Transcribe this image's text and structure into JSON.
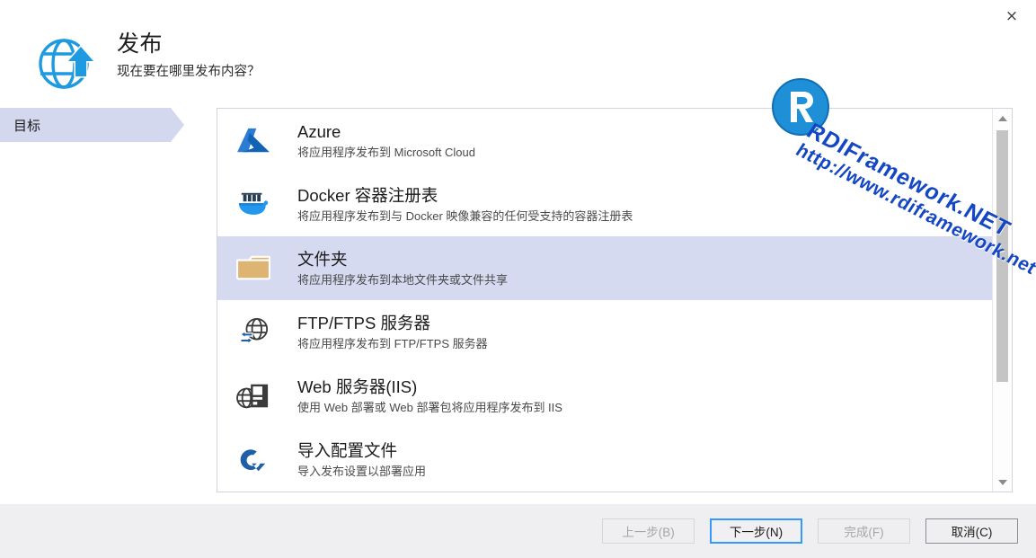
{
  "window": {
    "close_label": "×"
  },
  "header": {
    "icon": "globe-upload-icon",
    "title": "发布",
    "subtitle": "现在要在哪里发布内容？"
  },
  "sidebar": {
    "items": [
      {
        "label": "目标",
        "active": true
      }
    ]
  },
  "destinations": [
    {
      "icon": "azure-icon",
      "title": "Azure",
      "description": "将应用程序发布到 Microsoft Cloud",
      "selected": false
    },
    {
      "icon": "docker-icon",
      "title": "Docker 容器注册表",
      "description": "将应用程序发布到与 Docker 映像兼容的任何受支持的容器注册表",
      "selected": false
    },
    {
      "icon": "folder-icon",
      "title": "文件夹",
      "description": "将应用程序发布到本地文件夹或文件共享",
      "selected": true
    },
    {
      "icon": "ftp-icon",
      "title": "FTP/FTPS 服务器",
      "description": "将应用程序发布到 FTP/FTPS 服务器",
      "selected": false
    },
    {
      "icon": "iis-server-icon",
      "title": "Web 服务器(IIS)",
      "description": "使用 Web 部署或 Web 部署包将应用程序发布到 IIS",
      "selected": false
    },
    {
      "icon": "import-profile-icon",
      "title": "导入配置文件",
      "description": "导入发布设置以部署应用",
      "selected": false
    }
  ],
  "footer": {
    "buttons": [
      {
        "label": "上一步(B)",
        "state": "disabled"
      },
      {
        "label": "下一步(N)",
        "state": "focused"
      },
      {
        "label": "完成(F)",
        "state": "disabled"
      },
      {
        "label": "取消(C)",
        "state": "enabled"
      }
    ]
  },
  "watermark": {
    "logo": "rdi-r-logo",
    "line1": "RDIFramework.NET",
    "line2": "http://www.rdiframework.net",
    "color": "#1447c4"
  },
  "colors": {
    "selection": "#d5daf0",
    "sidebar_active": "#d3d8ef",
    "footer_bg": "#efeff1",
    "focus_border": "#3399ff",
    "azure_blue": "#0f6cbd",
    "folder_tan": "#ddb471",
    "docker_blue": "#2396ed"
  }
}
